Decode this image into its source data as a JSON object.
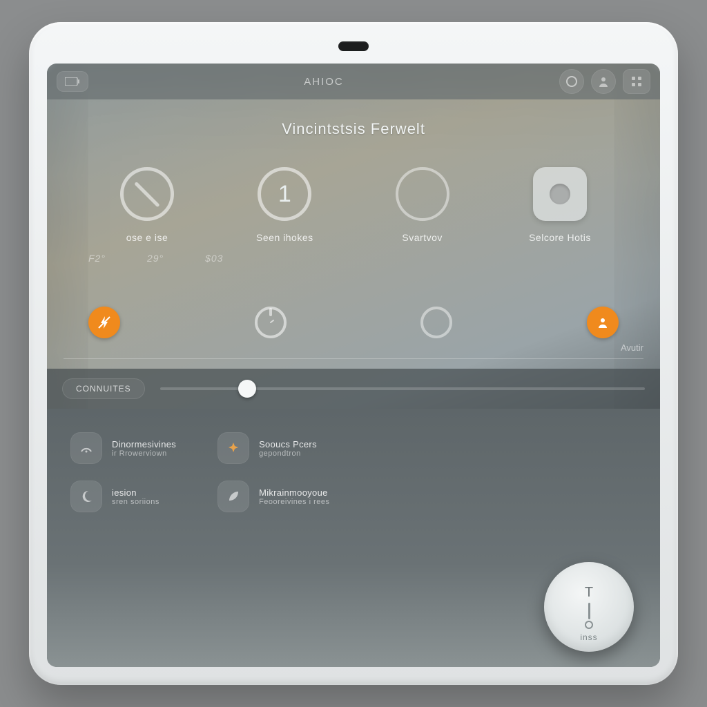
{
  "topbar": {
    "center_label": "AHIOC"
  },
  "title": "Vincintstsis Ferwelt",
  "row1": [
    {
      "label": "ose e ise"
    },
    {
      "label": "Seen ihokes",
      "digit": "1"
    },
    {
      "label": "Svartvov"
    },
    {
      "label": "Selcore Hotis"
    }
  ],
  "sub_row": {
    "a": "F2°",
    "b": "29°",
    "c": "$03"
  },
  "footer_label": "Avutir",
  "slider": {
    "chip": "CONNUITES"
  },
  "bottom_items": [
    {
      "line1": "Dinormesivines",
      "line2": "ir Rrowerviown"
    },
    {
      "line1": "iesion",
      "line2": "sren soriions"
    },
    {
      "line1": "Sooucs Pcers",
      "line2": "gepondtron"
    },
    {
      "line1": "Mikrainmooyoue",
      "line2": "Feooreivines i rees"
    }
  ],
  "dial": {
    "letter": "T",
    "label": "inss"
  }
}
